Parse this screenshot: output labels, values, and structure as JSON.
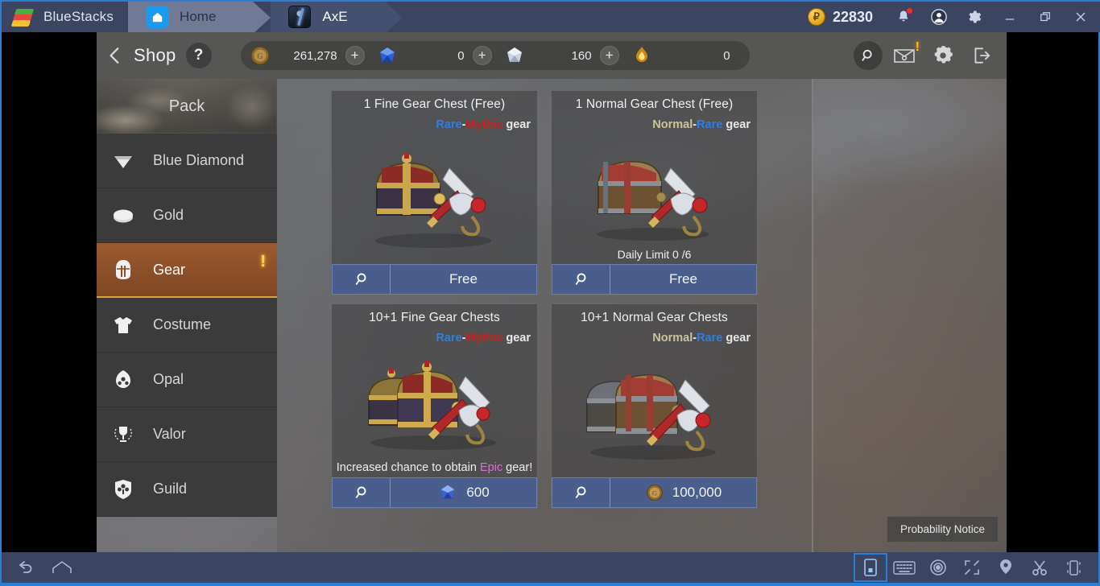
{
  "window": {
    "brand": "BlueStacks",
    "tabs": [
      {
        "label": "Home",
        "icon": "home-icon"
      },
      {
        "label": "AxE",
        "icon": "game-app-icon"
      }
    ],
    "points_value": "22830",
    "points_icon": "points-coin-icon",
    "controls": [
      {
        "name": "notifications-icon",
        "glyph": "bell"
      },
      {
        "name": "account-icon",
        "glyph": "person"
      },
      {
        "name": "settings-icon",
        "glyph": "gear"
      },
      {
        "name": "minimize-button",
        "glyph": "minimize"
      },
      {
        "name": "restore-button",
        "glyph": "restore"
      },
      {
        "name": "close-button",
        "glyph": "close"
      }
    ]
  },
  "game_header": {
    "back_icon": "back-chevron-icon",
    "title": "Shop",
    "help_label": "?",
    "currencies": [
      {
        "name": "gold",
        "icon": "gold-coin-icon",
        "value": "261,278",
        "plus": "+"
      },
      {
        "name": "blue-diamond",
        "icon": "blue-diamond-icon",
        "value": "0",
        "plus": "+"
      },
      {
        "name": "white-diamond",
        "icon": "white-diamond-icon",
        "value": "160",
        "plus": "+"
      },
      {
        "name": "flame",
        "icon": "flame-icon",
        "value": "0",
        "plus": ""
      }
    ],
    "tools": [
      {
        "name": "search-icon"
      },
      {
        "name": "mail-icon"
      },
      {
        "name": "settings-gear-icon"
      },
      {
        "name": "exit-icon"
      }
    ]
  },
  "sidebar": {
    "banner_label": "Pack",
    "items": [
      {
        "label": "Blue Diamond",
        "icon": "diamond-icon",
        "active": false,
        "badge": ""
      },
      {
        "label": "Gold",
        "icon": "gold-icon",
        "active": false,
        "badge": ""
      },
      {
        "label": "Gear",
        "icon": "helmet-icon",
        "active": true,
        "badge": "!"
      },
      {
        "label": "Costume",
        "icon": "shirt-icon",
        "active": false,
        "badge": ""
      },
      {
        "label": "Opal",
        "icon": "opal-icon",
        "active": false,
        "badge": ""
      },
      {
        "label": "Valor",
        "icon": "trophy-icon",
        "active": false,
        "badge": ""
      },
      {
        "label": "Guild",
        "icon": "guild-shield-icon",
        "active": false,
        "badge": ""
      }
    ]
  },
  "shop": {
    "cards": [
      {
        "title": "1 Fine Gear Chest (Free)",
        "grade_prefix": "Rare",
        "grade_dash": "-",
        "grade_suffix": "Mythic",
        "grade_tail": " gear",
        "grade_prefix_class": "g-rare",
        "grade_suffix_class": "g-mythic",
        "note": "",
        "chest_kind": "fine-single",
        "price_label": "Free",
        "price_icon": ""
      },
      {
        "title": "1 Normal Gear Chest (Free)",
        "grade_prefix": "Normal",
        "grade_dash": "-",
        "grade_suffix": "Rare",
        "grade_tail": " gear",
        "grade_prefix_class": "g-normal",
        "grade_suffix_class": "g-rare",
        "note": "Daily Limit 0 /6",
        "chest_kind": "normal-single",
        "price_label": "Free",
        "price_icon": ""
      },
      {
        "title": "10+1 Fine Gear Chests",
        "grade_prefix": "Rare",
        "grade_dash": "-",
        "grade_suffix": "Mythic",
        "grade_tail": " gear",
        "grade_prefix_class": "g-rare",
        "grade_suffix_class": "g-mythic",
        "note": "Increased chance to obtain Epic gear!",
        "note_highlight": "Epic",
        "chest_kind": "fine-multi",
        "price_label": "600",
        "price_icon": "blue-diamond-icon"
      },
      {
        "title": "10+1 Normal Gear Chests",
        "grade_prefix": "Normal",
        "grade_dash": "-",
        "grade_suffix": "Rare",
        "grade_tail": " gear",
        "grade_prefix_class": "g-normal",
        "grade_suffix_class": "g-rare",
        "note": "",
        "chest_kind": "normal-multi",
        "price_label": "100,000",
        "price_icon": "gold-coin-icon"
      }
    ],
    "probability_notice": "Probability Notice"
  },
  "bottom_toolbar": {
    "left": [
      {
        "name": "back-icon"
      },
      {
        "name": "home-icon"
      }
    ],
    "right": [
      {
        "name": "multi-instance-icon",
        "selected": true
      },
      {
        "name": "keyboard-controls-icon",
        "selected": false
      },
      {
        "name": "eye-macro-icon",
        "selected": false
      },
      {
        "name": "fullscreen-icon",
        "selected": false
      },
      {
        "name": "location-icon",
        "selected": false
      },
      {
        "name": "scissors-icon",
        "selected": false
      },
      {
        "name": "shake-device-icon",
        "selected": false
      }
    ]
  },
  "colors": {
    "accent_blue": "#2a7fd4",
    "titlebar": "#3b4460",
    "active_item": "#8d5029",
    "button_blue": "#4a5e8d"
  }
}
